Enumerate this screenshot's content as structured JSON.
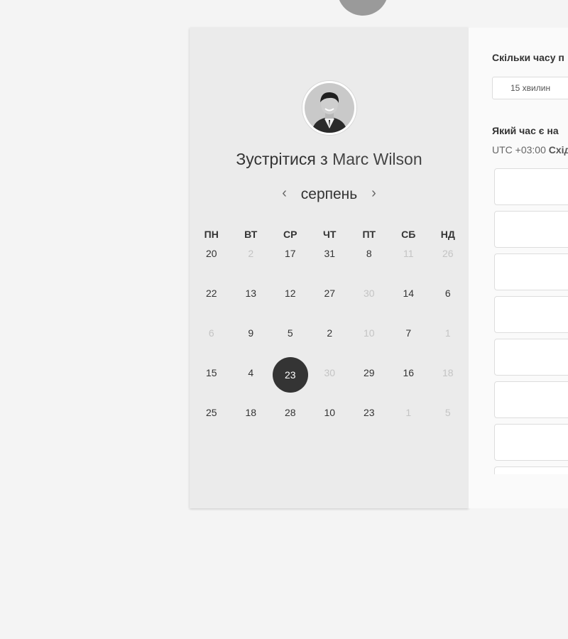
{
  "header": {
    "logo_icon": "speech-bubble-logo"
  },
  "calendar": {
    "host_avatar": "avatar-photo",
    "title_prefix": "Зустрітися з",
    "host_name": "Marc Wilson",
    "month": "серпень",
    "prev_icon": "chevron-left-icon",
    "next_icon": "chevron-right-icon",
    "weekdays": [
      "ПН",
      "ВТ",
      "СР",
      "ЧТ",
      "ПТ",
      "СБ",
      "НД"
    ],
    "weeks": [
      [
        {
          "d": "20",
          "m": false
        },
        {
          "d": "2",
          "m": true
        },
        {
          "d": "17",
          "m": false
        },
        {
          "d": "31",
          "m": false
        },
        {
          "d": "8",
          "m": false
        },
        {
          "d": "11",
          "m": true
        },
        {
          "d": "26",
          "m": true
        }
      ],
      [
        {
          "d": "22",
          "m": false
        },
        {
          "d": "13",
          "m": false
        },
        {
          "d": "12",
          "m": false
        },
        {
          "d": "27",
          "m": false
        },
        {
          "d": "30",
          "m": true
        },
        {
          "d": "14",
          "m": false
        },
        {
          "d": "6",
          "m": false
        }
      ],
      [
        {
          "d": "6",
          "m": true
        },
        {
          "d": "9",
          "m": false
        },
        {
          "d": "5",
          "m": false
        },
        {
          "d": "2",
          "m": false
        },
        {
          "d": "10",
          "m": true
        },
        {
          "d": "7",
          "m": false
        },
        {
          "d": "1",
          "m": true
        }
      ],
      [
        {
          "d": "15",
          "m": false
        },
        {
          "d": "4",
          "m": false
        },
        {
          "d": "23",
          "m": false,
          "selected": true
        },
        {
          "d": "30",
          "m": true
        },
        {
          "d": "29",
          "m": false
        },
        {
          "d": "16",
          "m": false
        },
        {
          "d": "18",
          "m": true
        }
      ],
      [
        {
          "d": "25",
          "m": false
        },
        {
          "d": "18",
          "m": false
        },
        {
          "d": "28",
          "m": false
        },
        {
          "d": "10",
          "m": false
        },
        {
          "d": "23",
          "m": false
        },
        {
          "d": "1",
          "m": true
        },
        {
          "d": "5",
          "m": true
        }
      ]
    ]
  },
  "booking": {
    "duration_question": "Скільки часу п",
    "duration_value": "15 хвилин",
    "time_question": "Який час є на",
    "tz_offset": "UTC +03:00",
    "tz_name": "Схід"
  }
}
